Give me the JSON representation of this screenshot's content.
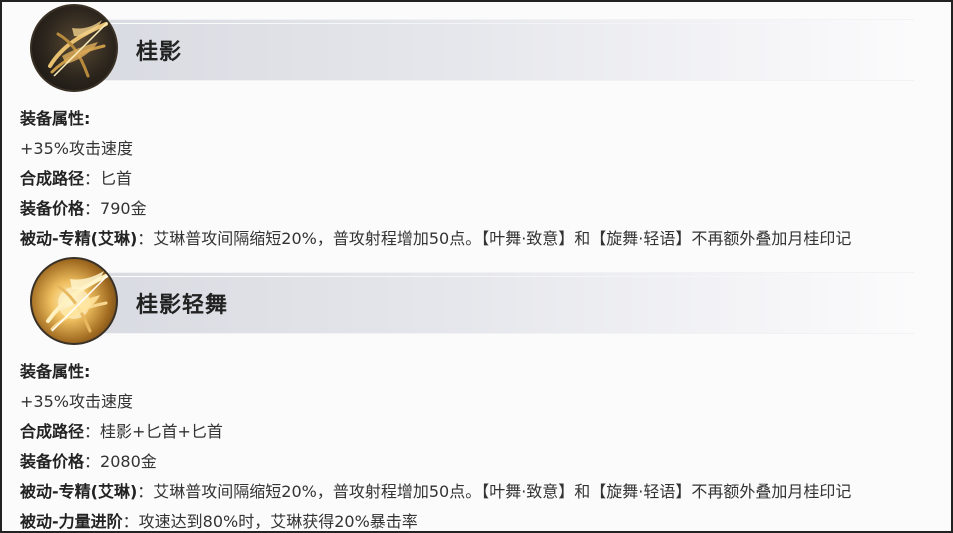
{
  "items": [
    {
      "name": "桂影",
      "icon": "golden-bow-icon",
      "attr_label": "装备属性:",
      "attr_value": "+35%攻击速度",
      "path_label": "合成路径",
      "path_value": "匕首",
      "price_label": "装备价格",
      "price_value": "790金",
      "passive_label": "被动-专精(艾琳)",
      "passive_value": "艾琳普攻间隔缩短20%，普攻射程增加50点。【叶舞·致意】和【旋舞·轻语】不再额外叠加月桂印记"
    },
    {
      "name": "桂影轻舞",
      "icon": "glowing-bow-icon",
      "attr_label": "装备属性:",
      "attr_value": "+35%攻击速度",
      "path_label": "合成路径",
      "path_value": "桂影+匕首+匕首",
      "price_label": "装备价格",
      "price_value": "2080金",
      "passive_label": "被动-专精(艾琳)",
      "passive_value": "艾琳普攻间隔缩短20%，普攻射程增加50点。【叶舞·致意】和【旋舞·轻语】不再额外叠加月桂印记",
      "passive2_label": "被动-力量进阶",
      "passive2_value": "攻速达到80%时，艾琳获得20%暴击率"
    }
  ],
  "colon": "："
}
